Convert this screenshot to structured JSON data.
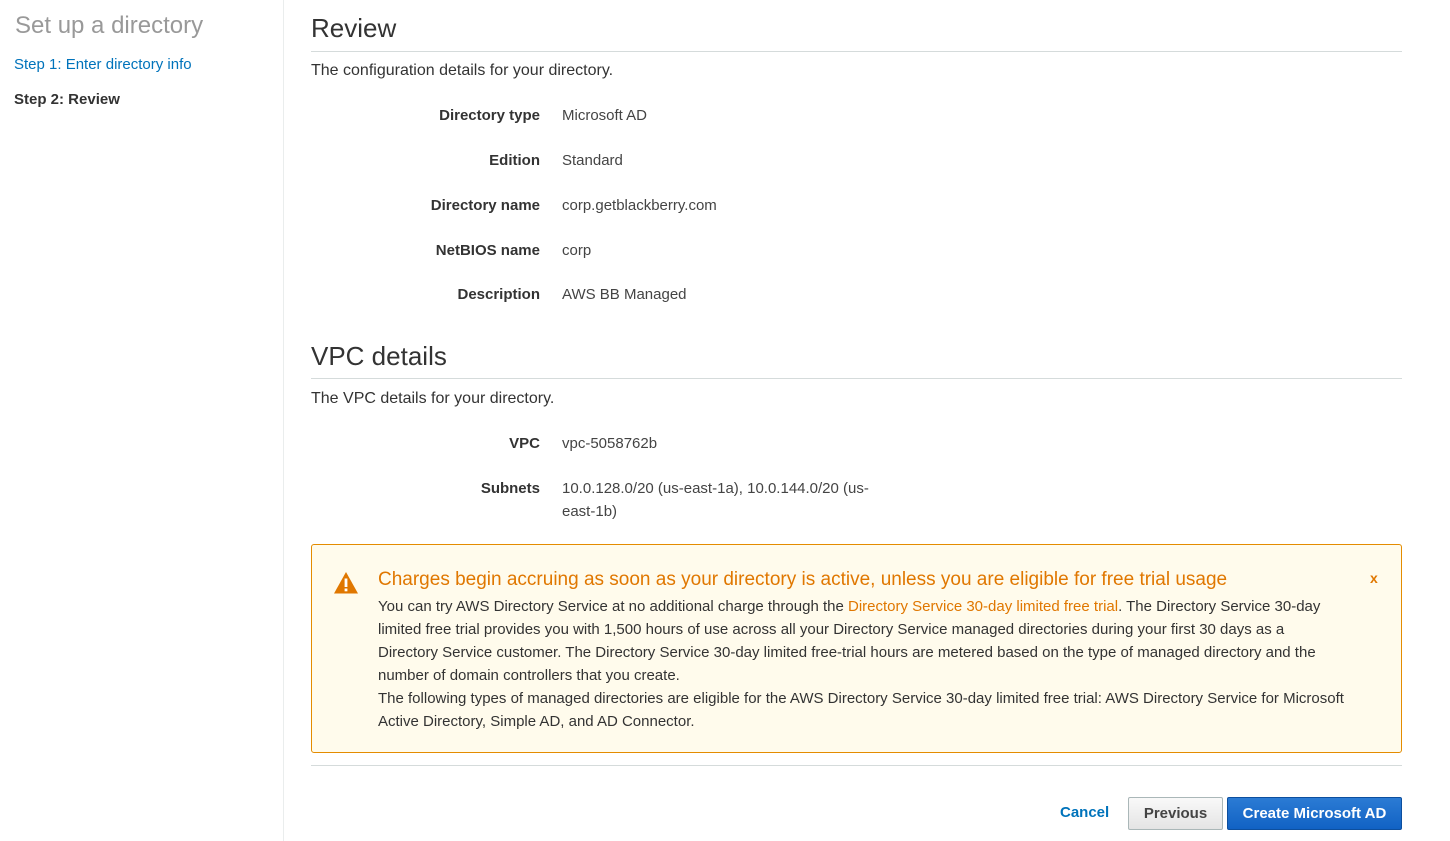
{
  "sidebar": {
    "title": "Set up a directory",
    "steps": [
      "Step 1: Enter directory info",
      "Step 2: Review"
    ]
  },
  "review": {
    "heading": "Review",
    "description": "The configuration details for your directory.",
    "fields": [
      {
        "label": "Directory type",
        "value": "Microsoft AD"
      },
      {
        "label": "Edition",
        "value": "Standard"
      },
      {
        "label": "Directory name",
        "value": "corp.getblackberry.com"
      },
      {
        "label": "NetBIOS name",
        "value": "corp"
      },
      {
        "label": "Description",
        "value": "AWS BB Managed"
      }
    ]
  },
  "vpc": {
    "heading": "VPC details",
    "description": "The VPC details for your directory.",
    "fields": [
      {
        "label": "VPC",
        "value": "vpc-5058762b"
      },
      {
        "label": "Subnets",
        "value": "10.0.128.0/20 (us-east-1a), 10.0.144.0/20 (us-east-1b)"
      }
    ]
  },
  "alert": {
    "icon": "warning-icon",
    "title": "Charges begin accruing as soon as your directory is active, unless you are eligible for free trial usage",
    "close": "x",
    "p1_before": "You can try AWS Directory Service at no additional charge through the ",
    "p1_link": "Directory Service 30-day limited free trial",
    "p1_after": ". The Directory Service 30-day limited free trial provides you with 1,500 hours of use across all your Directory Service managed directories during your first 30 days as a Directory Service customer. The Directory Service 30-day limited free-trial hours are metered based on the type of managed directory and the number of domain controllers that you create.",
    "p2": "The following types of managed directories are eligible for the AWS Directory Service 30-day limited free trial: AWS Directory Service for Microsoft Active Directory, Simple AD, and AD Connector."
  },
  "footer": {
    "cancel": "Cancel",
    "previous": "Previous",
    "create": "Create Microsoft AD"
  }
}
